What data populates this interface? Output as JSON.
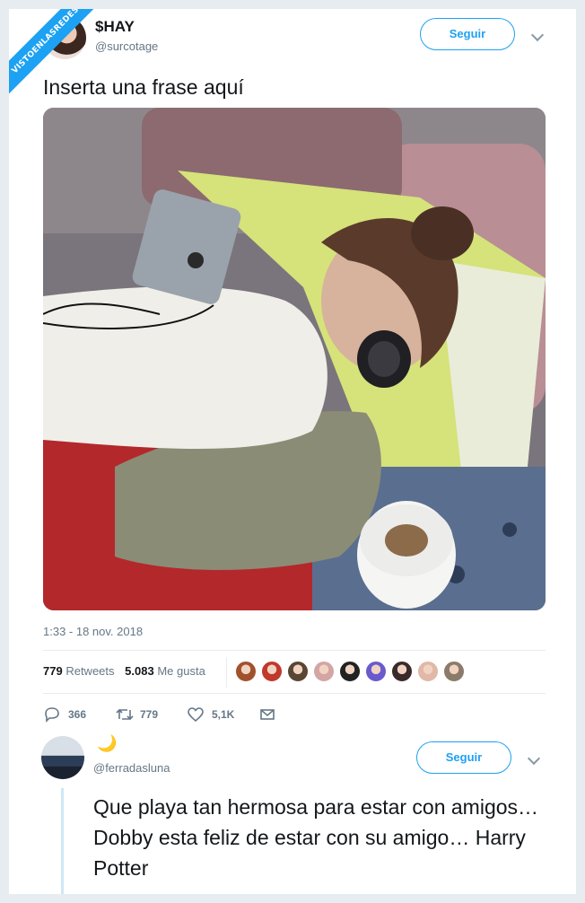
{
  "watermark": "VISTOENLASREDES",
  "tweet": {
    "display_name": "$HAY",
    "handle": "@surcotage",
    "follow_label": "Seguir",
    "text": "Inserta una frase aquí",
    "timestamp": "1:33 - 18 nov. 2018",
    "retweets_count": "779",
    "retweets_label": "Retweets",
    "likes_count": "5.083",
    "likes_label": "Me gusta",
    "actions": {
      "reply_count": "366",
      "retweet_count": "779",
      "like_count": "5,1K"
    },
    "liker_colors": [
      "#a0522d",
      "#c0392b",
      "#5a4632",
      "#d4a5a5",
      "#222222",
      "#6a5acd",
      "#3b2a2a",
      "#e0b8a8",
      "#8b7b6b"
    ]
  },
  "reply": {
    "display_name_emoji": "🌙",
    "handle": "@ferradasluna",
    "follow_label": "Seguir",
    "text": "Que playa tan hermosa para estar con amigos… Dobby esta feliz de estar con su amigo… Harry Potter"
  },
  "colors": {
    "accent": "#1da1f2",
    "muted": "#657786"
  }
}
